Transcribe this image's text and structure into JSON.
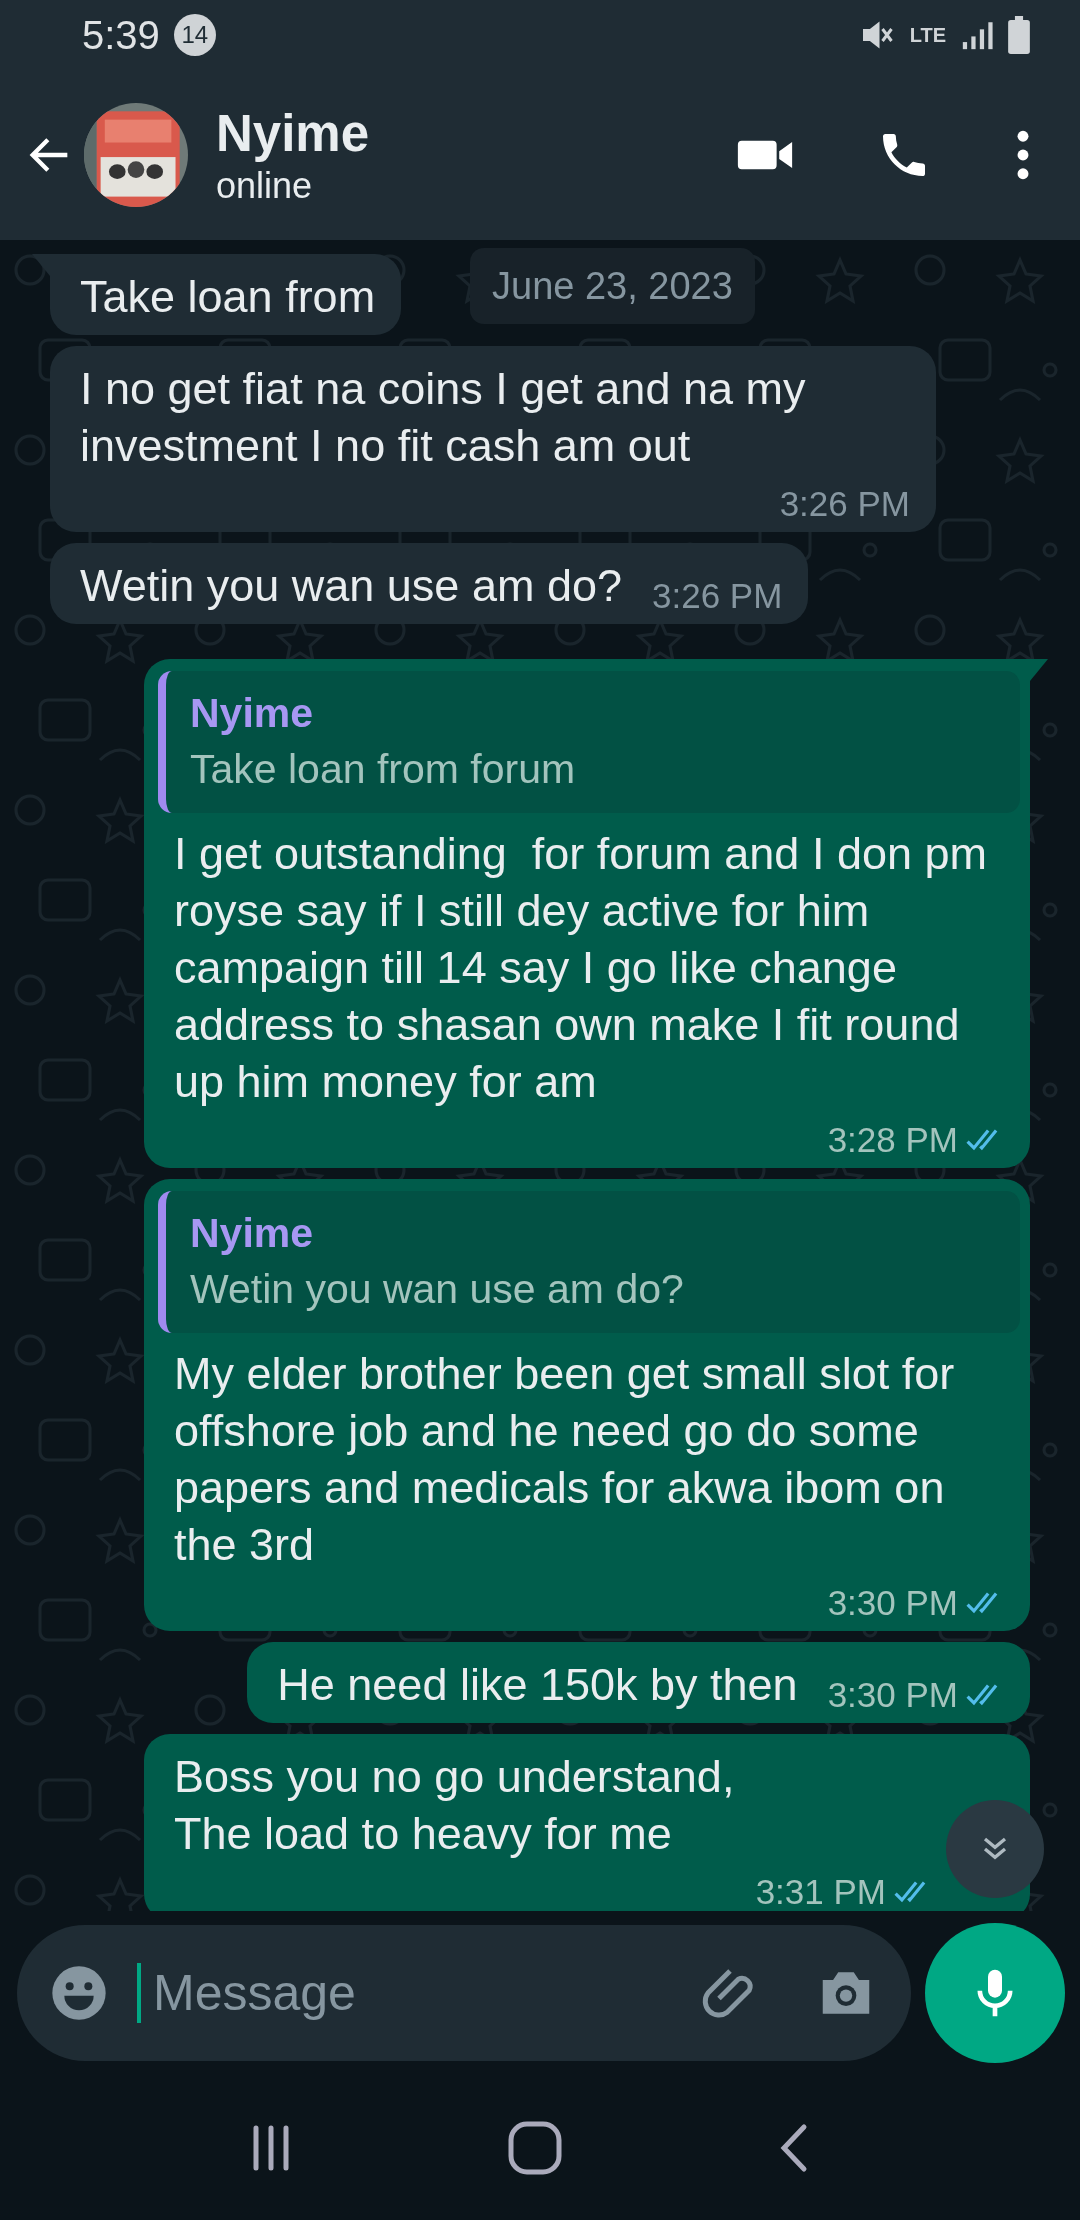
{
  "status_bar": {
    "time": "5:39",
    "notification_count": "14",
    "network": "LTE"
  },
  "header": {
    "contact_name": "Nyime",
    "status": "online"
  },
  "date_chip": "June 23, 2023",
  "messages": [
    {
      "outgoing": false,
      "tail": true,
      "text": "Take loan from"
    },
    {
      "outgoing": false,
      "tail": false,
      "text": "I no get fiat na coins I get and na my investment I no fit cash am out",
      "time": "3:26 PM"
    },
    {
      "outgoing": false,
      "tail": false,
      "text": "Wetin you wan use am do?",
      "time": "3:26 PM"
    },
    {
      "outgoing": true,
      "tail": true,
      "read": true,
      "quote": {
        "sender": "Nyime",
        "text": "Take loan from forum"
      },
      "text": "I get outstanding  for forum and I don pm royse say if I still dey active for him campaign till 14 say I go like change address to shasan own make I fit round up him money for am",
      "time": "3:28 PM"
    },
    {
      "outgoing": true,
      "tail": false,
      "read": true,
      "quote": {
        "sender": "Nyime",
        "text": "Wetin you wan use am do?"
      },
      "text": "My elder brother been get small slot for offshore job and he need go do some papers and medicals for akwa ibom on the 3rd",
      "time": "3:30 PM"
    },
    {
      "outgoing": true,
      "tail": false,
      "read": true,
      "text": "He need like 150k by then",
      "time": "3:30 PM"
    },
    {
      "outgoing": true,
      "tail": false,
      "read": true,
      "text": "Boss you no go understand,\nThe load to heavy for me",
      "time": "3:31 PM"
    }
  ],
  "composer": {
    "placeholder": "Message"
  }
}
